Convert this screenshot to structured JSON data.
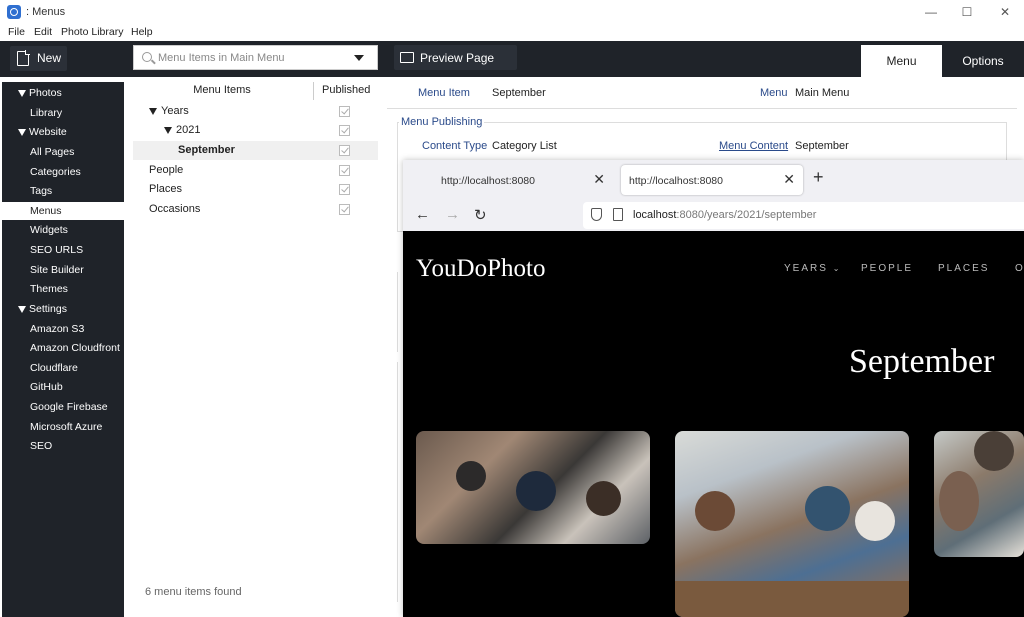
{
  "window": {
    "title": ": Menus",
    "minimize": "—",
    "maximize": "☐",
    "close": "✕"
  },
  "menubar": [
    "File",
    "Edit",
    "Photo Library",
    "Help"
  ],
  "toolbar": {
    "new_label": "New",
    "search_placeholder": "Menu Items in Main Menu",
    "preview_label": "Preview Page",
    "tab_menu": "Menu",
    "tab_options": "Options"
  },
  "sidebar": {
    "sections": [
      {
        "label": "Photos",
        "items": [
          "Library"
        ]
      },
      {
        "label": "Website",
        "items": [
          "All Pages",
          "Categories",
          "Tags",
          "Menus",
          "Widgets",
          "SEO URLS",
          "Site Builder",
          "Themes"
        ]
      },
      {
        "label": "Settings",
        "items": [
          "Amazon S3",
          "Amazon Cloudfront",
          "Cloudflare",
          "GitHub",
          "Google Firebase",
          "Microsoft Azure",
          "SEO"
        ]
      }
    ],
    "active": "Menus"
  },
  "tree": {
    "header_items": "Menu Items",
    "header_published": "Published",
    "rows": [
      {
        "label": "Years",
        "level": 0,
        "expanded": true,
        "published": true
      },
      {
        "label": "2021",
        "level": 1,
        "expanded": true,
        "published": true
      },
      {
        "label": "September",
        "level": 2,
        "expanded": false,
        "published": true,
        "selected": true
      },
      {
        "label": "People",
        "level": 0,
        "expanded": false,
        "published": true
      },
      {
        "label": "Places",
        "level": 0,
        "expanded": false,
        "published": true
      },
      {
        "label": "Occasions",
        "level": 0,
        "expanded": false,
        "published": true
      }
    ],
    "status": "6 menu items found"
  },
  "detail": {
    "menu_item_label": "Menu Item",
    "menu_item_value": "September",
    "menu_label": "Menu",
    "menu_value": "Main Menu",
    "publishing_title": "Menu Publishing",
    "content_type_label": "Content Type",
    "content_type_value": "Category List",
    "menu_content_label": "Menu Content",
    "menu_content_value": "September"
  },
  "browser": {
    "tabs": [
      {
        "title": "http://localhost:8080",
        "active": false
      },
      {
        "title": "http://localhost:8080",
        "active": true
      }
    ],
    "url_host": "localhost",
    "url_rest": ":8080/years/2021/september",
    "site_logo": "YouDoPhoto",
    "site_nav": [
      "YEARS",
      "PEOPLE",
      "PLACES",
      "O"
    ],
    "page_heading": "September"
  }
}
